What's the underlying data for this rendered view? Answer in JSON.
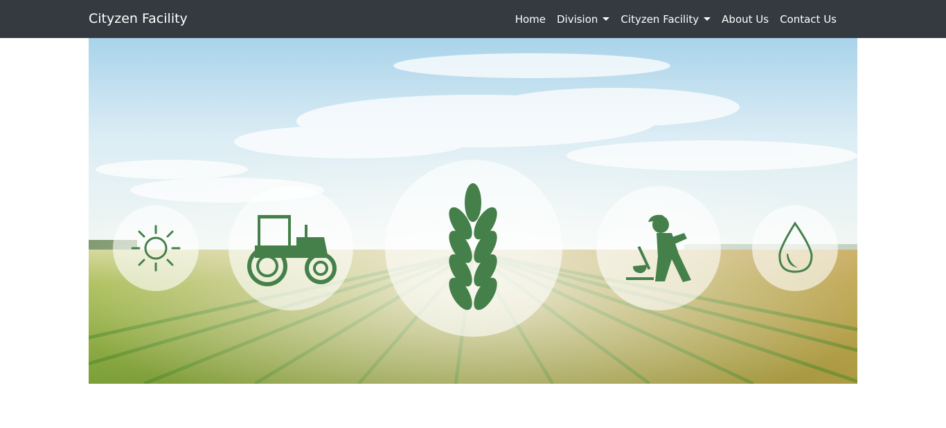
{
  "navbar": {
    "brand": "Cityzen Facility",
    "items": [
      {
        "label": "Home",
        "dropdown": false
      },
      {
        "label": "Division",
        "dropdown": true
      },
      {
        "label": "Cityzen Facility",
        "dropdown": true
      },
      {
        "label": "About Us",
        "dropdown": false
      },
      {
        "label": "Contact Us",
        "dropdown": false
      }
    ]
  },
  "hero": {
    "icons": [
      "sun-icon",
      "tractor-icon",
      "wheat-icon",
      "farmer-digging-icon",
      "water-drop-icon"
    ],
    "colors": {
      "icon_green": "#45804a",
      "sky_top": "#a9d3ea",
      "field_green": "#86b33c",
      "soil": "#b98f45"
    }
  },
  "colors": {
    "navbar_bg": "#343a40",
    "nav_text": "#ffffff"
  }
}
